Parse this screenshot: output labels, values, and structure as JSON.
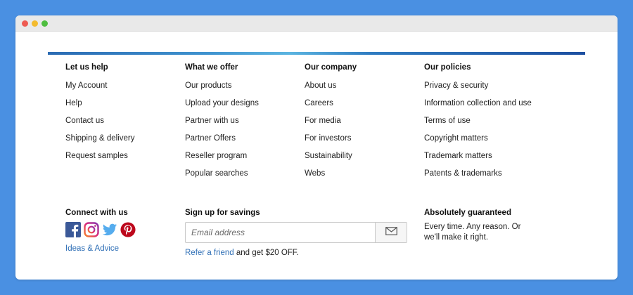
{
  "columns": [
    {
      "heading": "Let us help",
      "items": [
        "My Account",
        "Help",
        "Contact us",
        "Shipping & delivery",
        "Request samples"
      ]
    },
    {
      "heading": "What we offer",
      "items": [
        "Our products",
        "Upload your designs",
        "Partner with us",
        "Partner Offers",
        "Reseller program",
        "Popular searches"
      ]
    },
    {
      "heading": "Our company",
      "items": [
        "About us",
        "Careers",
        "For media",
        "For investors",
        "Sustainability",
        "Webs"
      ]
    },
    {
      "heading": "Our policies",
      "items": [
        "Privacy & security",
        "Information collection and use",
        "Terms of use",
        "Copyright matters",
        "Trademark matters",
        "Patents & trademarks"
      ]
    }
  ],
  "connect": {
    "heading": "Connect with us",
    "icons": [
      "facebook-icon",
      "instagram-icon",
      "twitter-icon",
      "pinterest-icon"
    ],
    "ideas_link": "Ideas & Advice"
  },
  "signup": {
    "heading": "Sign up for savings",
    "placeholder": "Email address",
    "refer_link": "Refer a friend",
    "refer_text": " and get $20 OFF.",
    "button_icon": "envelope-icon"
  },
  "guarantee": {
    "heading": "Absolutely guaranteed",
    "text": "Every time. Any reason. Or we'll make it right."
  },
  "colors": {
    "background": "#4a90e2",
    "link": "#2f6fb6",
    "facebook": "#3b5998",
    "twitter": "#55acee",
    "pinterest": "#bd081c"
  }
}
